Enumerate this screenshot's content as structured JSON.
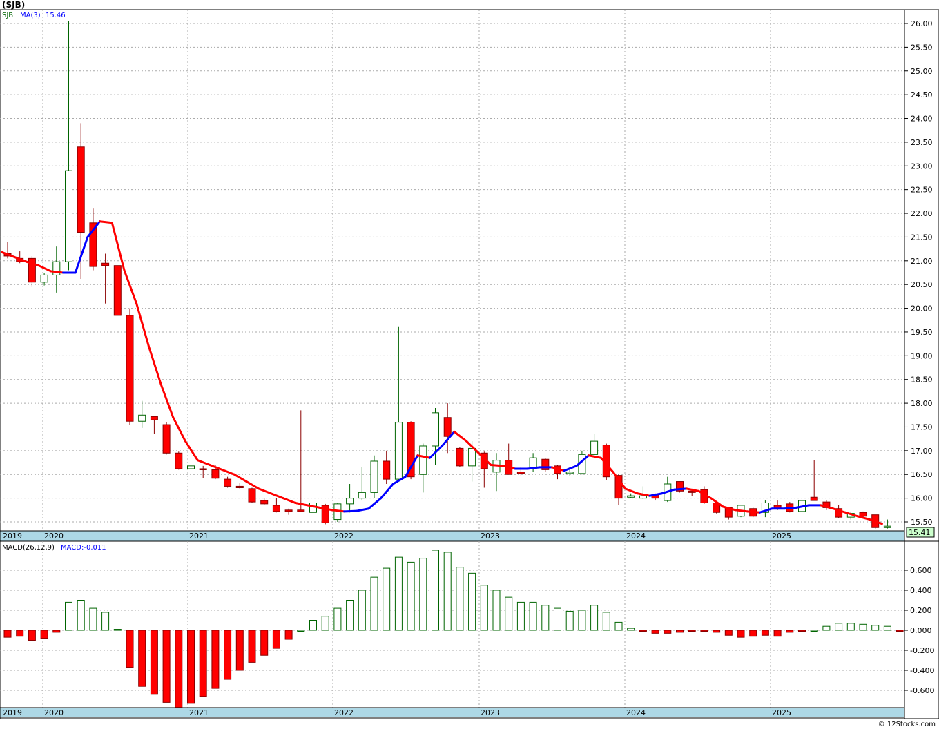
{
  "title": "(SJB)",
  "legend": {
    "ticker": "SJB",
    "ma_label": "MA(3)",
    "ma_value": "15.46",
    "macd_label": "MACD(26,12,9)",
    "macd_value": "MACD:-0.011"
  },
  "last_price_label": "15.41",
  "watermark": "© 12Stocks.com",
  "colors": {
    "up": "#006400",
    "down": "#ff0000",
    "ma_up": "#0000ff",
    "ma_down": "#ff0000",
    "axis_band": "#add8e6",
    "price_box": "#ccffcc"
  },
  "chart_data": [
    {
      "type": "candlestick",
      "title": "(SJB)",
      "period": "monthly",
      "ylim": [
        15.35,
        26.2
      ],
      "yticks": [
        "26.00",
        "25.50",
        "25.00",
        "24.50",
        "24.00",
        "23.50",
        "23.00",
        "22.50",
        "22.00",
        "21.50",
        "21.00",
        "20.50",
        "20.00",
        "19.50",
        "19.00",
        "18.50",
        "18.00",
        "17.50",
        "17.00",
        "16.50",
        "16.00",
        "15.50"
      ],
      "year_labels": [
        "2019",
        "2020",
        "2021",
        "2022",
        "2023",
        "2024",
        "2025"
      ],
      "candles": [
        {
          "o": 21.15,
          "h": 21.4,
          "l": 21.05,
          "c": 21.1
        },
        {
          "o": 21.05,
          "h": 21.2,
          "l": 20.95,
          "c": 20.98
        },
        {
          "o": 21.05,
          "h": 21.1,
          "l": 20.45,
          "c": 20.55
        },
        {
          "o": 20.55,
          "h": 20.75,
          "l": 20.48,
          "c": 20.7
        },
        {
          "o": 20.7,
          "h": 21.3,
          "l": 20.33,
          "c": 20.98
        },
        {
          "o": 20.98,
          "h": 26.05,
          "l": 20.8,
          "c": 22.9
        },
        {
          "o": 23.4,
          "h": 23.9,
          "l": 20.62,
          "c": 21.6
        },
        {
          "o": 21.8,
          "h": 22.1,
          "l": 20.8,
          "c": 20.88
        },
        {
          "o": 20.95,
          "h": 21.15,
          "l": 20.1,
          "c": 20.9
        },
        {
          "o": 20.9,
          "h": 20.9,
          "l": 19.85,
          "c": 19.85
        },
        {
          "o": 19.85,
          "h": 20.0,
          "l": 17.55,
          "c": 17.62
        },
        {
          "o": 17.62,
          "h": 18.05,
          "l": 17.48,
          "c": 17.75
        },
        {
          "o": 17.72,
          "h": 17.72,
          "l": 17.35,
          "c": 17.65
        },
        {
          "o": 17.55,
          "h": 17.6,
          "l": 16.92,
          "c": 16.95
        },
        {
          "o": 16.95,
          "h": 16.98,
          "l": 16.6,
          "c": 16.62
        },
        {
          "o": 16.62,
          "h": 16.72,
          "l": 16.55,
          "c": 16.68
        },
        {
          "o": 16.62,
          "h": 16.68,
          "l": 16.42,
          "c": 16.6
        },
        {
          "o": 16.6,
          "h": 16.7,
          "l": 16.4,
          "c": 16.42
        },
        {
          "o": 16.4,
          "h": 16.45,
          "l": 16.22,
          "c": 16.25
        },
        {
          "o": 16.25,
          "h": 16.32,
          "l": 16.2,
          "c": 16.22
        },
        {
          "o": 16.2,
          "h": 16.22,
          "l": 15.9,
          "c": 15.92
        },
        {
          "o": 15.95,
          "h": 16.0,
          "l": 15.85,
          "c": 15.88
        },
        {
          "o": 15.85,
          "h": 16.0,
          "l": 15.7,
          "c": 15.72
        },
        {
          "o": 15.75,
          "h": 15.78,
          "l": 15.65,
          "c": 15.72
        },
        {
          "o": 15.75,
          "h": 17.85,
          "l": 15.72,
          "c": 15.72
        },
        {
          "o": 15.7,
          "h": 17.85,
          "l": 15.6,
          "c": 15.9
        },
        {
          "o": 15.85,
          "h": 15.88,
          "l": 15.45,
          "c": 15.48
        },
        {
          "o": 15.55,
          "h": 15.9,
          "l": 15.5,
          "c": 15.88
        },
        {
          "o": 15.88,
          "h": 16.3,
          "l": 15.7,
          "c": 16.0
        },
        {
          "o": 16.0,
          "h": 16.65,
          "l": 15.95,
          "c": 16.12
        },
        {
          "o": 16.12,
          "h": 16.9,
          "l": 16.0,
          "c": 16.78
        },
        {
          "o": 16.78,
          "h": 17.0,
          "l": 16.3,
          "c": 16.4
        },
        {
          "o": 16.4,
          "h": 19.62,
          "l": 16.35,
          "c": 17.6
        },
        {
          "o": 17.6,
          "h": 17.62,
          "l": 16.4,
          "c": 16.45
        },
        {
          "o": 16.5,
          "h": 17.15,
          "l": 16.12,
          "c": 17.1
        },
        {
          "o": 17.1,
          "h": 17.9,
          "l": 16.7,
          "c": 17.8
        },
        {
          "o": 17.7,
          "h": 18.0,
          "l": 16.95,
          "c": 17.3
        },
        {
          "o": 17.05,
          "h": 17.08,
          "l": 16.65,
          "c": 16.68
        },
        {
          "o": 16.68,
          "h": 17.2,
          "l": 16.35,
          "c": 17.05
        },
        {
          "o": 16.95,
          "h": 16.98,
          "l": 16.22,
          "c": 16.62
        },
        {
          "o": 16.55,
          "h": 16.95,
          "l": 16.15,
          "c": 16.8
        },
        {
          "o": 16.8,
          "h": 17.15,
          "l": 16.5,
          "c": 16.5
        },
        {
          "o": 16.55,
          "h": 16.65,
          "l": 16.48,
          "c": 16.52
        },
        {
          "o": 16.62,
          "h": 16.95,
          "l": 16.55,
          "c": 16.85
        },
        {
          "o": 16.82,
          "h": 16.85,
          "l": 16.55,
          "c": 16.6
        },
        {
          "o": 16.68,
          "h": 16.7,
          "l": 16.4,
          "c": 16.52
        },
        {
          "o": 16.52,
          "h": 16.65,
          "l": 16.48,
          "c": 16.55
        },
        {
          "o": 16.52,
          "h": 17.0,
          "l": 16.5,
          "c": 16.92
        },
        {
          "o": 16.92,
          "h": 17.35,
          "l": 16.9,
          "c": 17.2
        },
        {
          "o": 17.12,
          "h": 17.15,
          "l": 16.38,
          "c": 16.45
        },
        {
          "o": 16.48,
          "h": 16.5,
          "l": 15.85,
          "c": 16.0
        },
        {
          "o": 16.02,
          "h": 16.1,
          "l": 16.0,
          "c": 16.05
        },
        {
          "o": 16.0,
          "h": 16.25,
          "l": 15.98,
          "c": 16.05
        },
        {
          "o": 16.08,
          "h": 16.1,
          "l": 15.95,
          "c": 16.0
        },
        {
          "o": 15.95,
          "h": 16.45,
          "l": 15.92,
          "c": 16.3
        },
        {
          "o": 16.35,
          "h": 16.35,
          "l": 16.12,
          "c": 16.15
        },
        {
          "o": 16.15,
          "h": 16.2,
          "l": 16.05,
          "c": 16.12
        },
        {
          "o": 16.18,
          "h": 16.25,
          "l": 15.88,
          "c": 15.9
        },
        {
          "o": 15.9,
          "h": 15.92,
          "l": 15.68,
          "c": 15.7
        },
        {
          "o": 15.8,
          "h": 15.82,
          "l": 15.55,
          "c": 15.6
        },
        {
          "o": 15.62,
          "h": 15.85,
          "l": 15.6,
          "c": 15.85
        },
        {
          "o": 15.78,
          "h": 15.8,
          "l": 15.6,
          "c": 15.62
        },
        {
          "o": 15.7,
          "h": 15.95,
          "l": 15.6,
          "c": 15.9
        },
        {
          "o": 15.85,
          "h": 15.95,
          "l": 15.75,
          "c": 15.78
        },
        {
          "o": 15.88,
          "h": 15.92,
          "l": 15.7,
          "c": 15.72
        },
        {
          "o": 15.72,
          "h": 16.05,
          "l": 15.72,
          "c": 15.95
        },
        {
          "o": 16.02,
          "h": 16.8,
          "l": 15.95,
          "c": 15.95
        },
        {
          "o": 15.92,
          "h": 15.95,
          "l": 15.75,
          "c": 15.8
        },
        {
          "o": 15.78,
          "h": 15.85,
          "l": 15.58,
          "c": 15.6
        },
        {
          "o": 15.6,
          "h": 15.72,
          "l": 15.55,
          "c": 15.68
        },
        {
          "o": 15.7,
          "h": 15.72,
          "l": 15.6,
          "c": 15.62
        },
        {
          "o": 15.65,
          "h": 15.65,
          "l": 15.35,
          "c": 15.38
        },
        {
          "o": 15.38,
          "h": 15.55,
          "l": 15.36,
          "c": 15.41
        }
      ],
      "ma3": [
        21.18,
        21.08,
        20.98,
        20.9,
        20.78,
        20.75,
        20.75,
        21.5,
        21.83,
        21.8,
        20.8,
        20.1,
        19.2,
        18.4,
        17.7,
        17.2,
        16.8,
        16.7,
        16.6,
        16.5,
        16.35,
        16.2,
        16.1,
        16.0,
        15.9,
        15.85,
        15.8,
        15.75,
        15.72,
        15.73,
        15.78,
        16.0,
        16.3,
        16.45,
        16.9,
        16.85,
        17.1,
        17.4,
        17.2,
        16.95,
        16.7,
        16.68,
        16.62,
        16.62,
        16.65,
        16.65,
        16.58,
        16.68,
        16.9,
        16.85,
        16.55,
        16.2,
        16.1,
        16.05,
        16.1,
        16.18,
        16.2,
        16.15,
        16.0,
        15.82,
        15.75,
        15.72,
        15.7,
        15.78,
        15.78,
        15.8,
        15.85,
        15.85,
        15.78,
        15.7,
        15.62,
        15.55,
        15.46
      ]
    },
    {
      "type": "bar",
      "title": "MACD(26,12,9)",
      "ylim": [
        -0.78,
        0.78
      ],
      "yticks": [
        "0.600",
        "0.400",
        "0.200",
        "0.000",
        "-0.200",
        "-0.400",
        "-0.600"
      ],
      "year_labels": [
        "2019",
        "2020",
        "2021",
        "2022",
        "2023",
        "2024",
        "2025"
      ],
      "values": [
        -0.07,
        -0.06,
        -0.1,
        -0.08,
        -0.02,
        0.28,
        0.3,
        0.22,
        0.18,
        0.01,
        -0.37,
        -0.56,
        -0.64,
        -0.72,
        -0.78,
        -0.73,
        -0.66,
        -0.58,
        -0.49,
        -0.4,
        -0.32,
        -0.25,
        -0.18,
        -0.09,
        0.0,
        0.1,
        0.14,
        0.22,
        0.3,
        0.4,
        0.53,
        0.62,
        0.73,
        0.68,
        0.72,
        0.8,
        0.78,
        0.63,
        0.57,
        0.45,
        0.4,
        0.33,
        0.28,
        0.28,
        0.25,
        0.22,
        0.19,
        0.2,
        0.25,
        0.18,
        0.08,
        0.02,
        -0.01,
        -0.03,
        -0.03,
        -0.02,
        -0.01,
        -0.01,
        -0.02,
        -0.05,
        -0.07,
        -0.06,
        -0.05,
        -0.06,
        -0.02,
        -0.01,
        0.0,
        0.04,
        0.07,
        0.07,
        0.06,
        0.05,
        0.04,
        -0.01,
        -0.011
      ]
    }
  ]
}
